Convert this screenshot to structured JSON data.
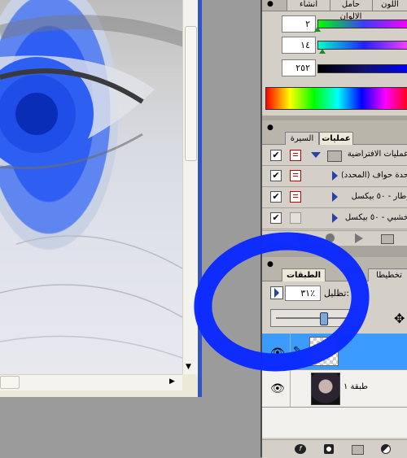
{
  "color_panel": {
    "tabs": [
      "اللون",
      "حامل الالوان",
      "انشاء"
    ],
    "values": [
      "٢",
      "١٤",
      "٢٥٢"
    ],
    "colors": {
      "slider1": "#3b3bff",
      "slider2": "#2020ff",
      "slider3": "#101070"
    }
  },
  "actions_panel": {
    "tabs": [
      "عمليات",
      "السيرة"
    ],
    "rows": [
      {
        "label": "عمليات الافتراضية",
        "kind": "set"
      },
      {
        "label": "حدة حواف (المحدد)",
        "kind": "action"
      },
      {
        "label": "إطار - ٥٠ بيكسل",
        "kind": "action"
      },
      {
        "label": "خشبي - ٥٠ بيكسل",
        "kind": "action"
      }
    ]
  },
  "layers_panel": {
    "tabs": [
      "الطبقات",
      "تخطيطا"
    ],
    "opacity_label": "تظليل:",
    "opacity_value": "٣١٪",
    "opacity_fraction": 0.31,
    "layers": [
      {
        "name": "",
        "selected": true,
        "thumb": "transparent"
      },
      {
        "name": "طبقة ١",
        "selected": false,
        "thumb": "face"
      }
    ]
  },
  "accent_colors": {
    "selection": "#3b9bff",
    "annotation_ring": "#0b2bff"
  },
  "icons": [
    "eye-icon",
    "brush-icon",
    "folder-icon",
    "stop-icon",
    "record-icon",
    "play-icon",
    "move-icon",
    "fx-icon",
    "mask-icon",
    "new-layer-icon",
    "adjustment-icon"
  ]
}
